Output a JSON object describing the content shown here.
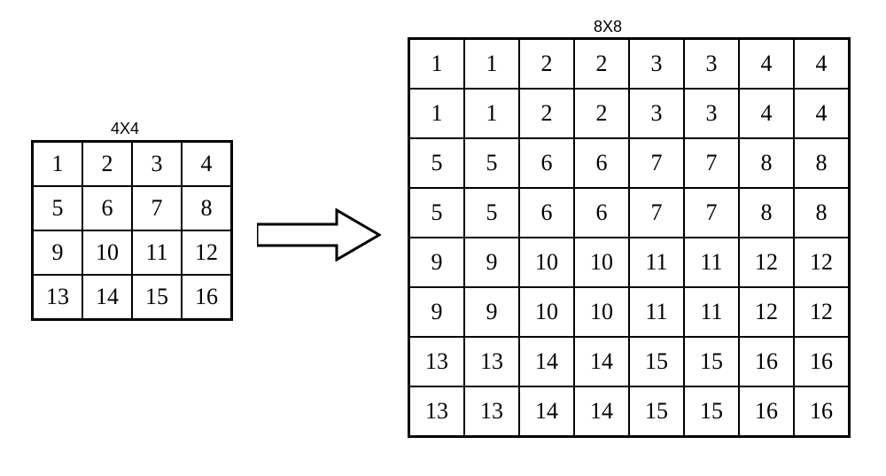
{
  "label4x4": "4X4",
  "label8x8": "8X8",
  "grid4x4": [
    [
      "1",
      "2",
      "3",
      "4"
    ],
    [
      "5",
      "6",
      "7",
      "8"
    ],
    [
      "9",
      "10",
      "11",
      "12"
    ],
    [
      "13",
      "14",
      "15",
      "16"
    ]
  ],
  "grid8x8": [
    [
      "1",
      "1",
      "2",
      "2",
      "3",
      "3",
      "4",
      "4"
    ],
    [
      "1",
      "1",
      "2",
      "2",
      "3",
      "3",
      "4",
      "4"
    ],
    [
      "5",
      "5",
      "6",
      "6",
      "7",
      "7",
      "8",
      "8"
    ],
    [
      "5",
      "5",
      "6",
      "6",
      "7",
      "7",
      "8",
      "8"
    ],
    [
      "9",
      "9",
      "10",
      "10",
      "11",
      "11",
      "12",
      "12"
    ],
    [
      "9",
      "9",
      "10",
      "10",
      "11",
      "11",
      "12",
      "12"
    ],
    [
      "13",
      "13",
      "14",
      "14",
      "15",
      "15",
      "16",
      "16"
    ],
    [
      "13",
      "13",
      "14",
      "14",
      "15",
      "15",
      "16",
      "16"
    ]
  ]
}
